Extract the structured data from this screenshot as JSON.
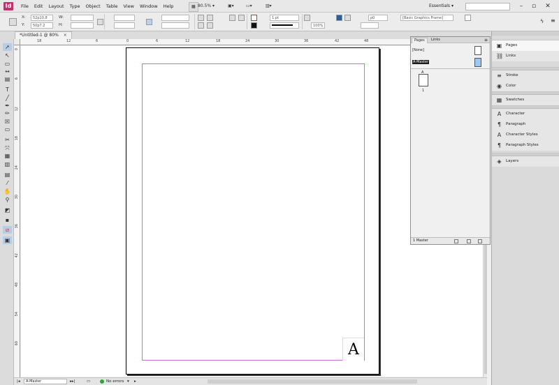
{
  "app": {
    "logo": "Id"
  },
  "menu": [
    "File",
    "Edit",
    "Layout",
    "Type",
    "Object",
    "Table",
    "View",
    "Window",
    "Help"
  ],
  "menubar": {
    "zoom": "80.5%",
    "workspace": "Essentials"
  },
  "control": {
    "x_label": "X:",
    "x_value": "52p10.8",
    "y_label": "Y:",
    "y_value": "50p7.2",
    "w_label": "W:",
    "h_label": "H:",
    "stroke_weight": "1 pt",
    "scale_percent": "100%",
    "gap_value": "p0",
    "frame_style": "[Basic Graphics Frame]"
  },
  "document": {
    "tab_title": "*Untitled-1 @ 80%",
    "close_symbol": "×"
  },
  "rulers": {
    "top": [
      "18",
      "12",
      "6",
      "0",
      "6",
      "12",
      "18",
      "24",
      "30",
      "36",
      "42",
      "48"
    ],
    "left": [
      "0",
      "6",
      "12",
      "18",
      "24",
      "30",
      "36",
      "42",
      "48",
      "54",
      "60"
    ]
  },
  "page": {
    "master_letter": "A",
    "guide_color": "#c86bd6"
  },
  "pages_panel": {
    "tabs": [
      "Pages",
      "Links"
    ],
    "menu_symbol": "≡",
    "masters": [
      "[None]",
      "A-Master"
    ],
    "page_prefix": "A",
    "page_number": "1",
    "footer": "1 Master"
  },
  "dock": {
    "group1": [
      "Pages",
      "Links"
    ],
    "group2": [
      "Stroke",
      "Color"
    ],
    "group3": [
      "Swatches"
    ],
    "group4": [
      "Character",
      "Paragraph",
      "Character Styles",
      "Paragraph Styles"
    ],
    "group5": [
      "Layers"
    ]
  },
  "statusbar": {
    "page_field": "A-Master",
    "preflight": "No errors"
  }
}
